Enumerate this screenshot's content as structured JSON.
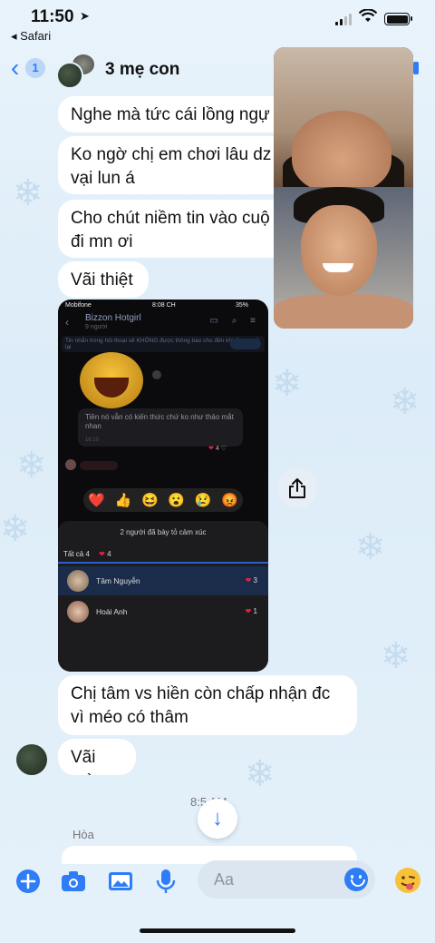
{
  "status_bar": {
    "time": "11:50",
    "back_app": "◂ Safari"
  },
  "header": {
    "back_count": "1",
    "title": "3 mẹ con"
  },
  "messages": [
    {
      "text": "Nghe mà tức cái lồng ngự"
    },
    {
      "text": "Ko ngờ chị em chơi lâu dz\nvại lun á"
    },
    {
      "text": "Cho chút niềm tin vào cuộ\nđi mn ơi"
    },
    {
      "text": "Vãi thiệt"
    },
    {
      "text": "Chị tâm vs hiền còn chấp nhận đc\nvì méo có thâm"
    },
    {
      "text": "Vãi mà"
    }
  ],
  "embedded_screenshot": {
    "carrier": "Mobifone",
    "clock": "8:08 CH",
    "battery": "35%",
    "chat_name": "Bizzon Hotgirl",
    "chat_sub": "9 người",
    "notice": "Tin nhắn trong hội thoại sẽ KHÔNG được thông báo cho đến khi được mở lại",
    "message": "Tiền nó vẫn có kiến thức chứ ko như thảo mắt nhan",
    "msg_time": "16:10",
    "reaction_count": "4",
    "reaction_emojis": [
      "❤️",
      "👍",
      "😆",
      "😮",
      "😢",
      "😡"
    ],
    "sheet_title": "2 người đã bày tỏ cảm xúc",
    "tab_all": "Tất cả  4",
    "tab_heart_count": "4",
    "reactors": [
      {
        "name": "Tâm Nguyễn",
        "count": "3"
      },
      {
        "name": "Hoài Anh",
        "count": "1"
      }
    ]
  },
  "time_separator": "8:5 AM",
  "sender_label": "Hòa",
  "composer": {
    "placeholder": "Aa"
  },
  "colors": {
    "accent": "#2e7cf6",
    "bubble": "#ffffff",
    "background": "#e5f1fa"
  }
}
